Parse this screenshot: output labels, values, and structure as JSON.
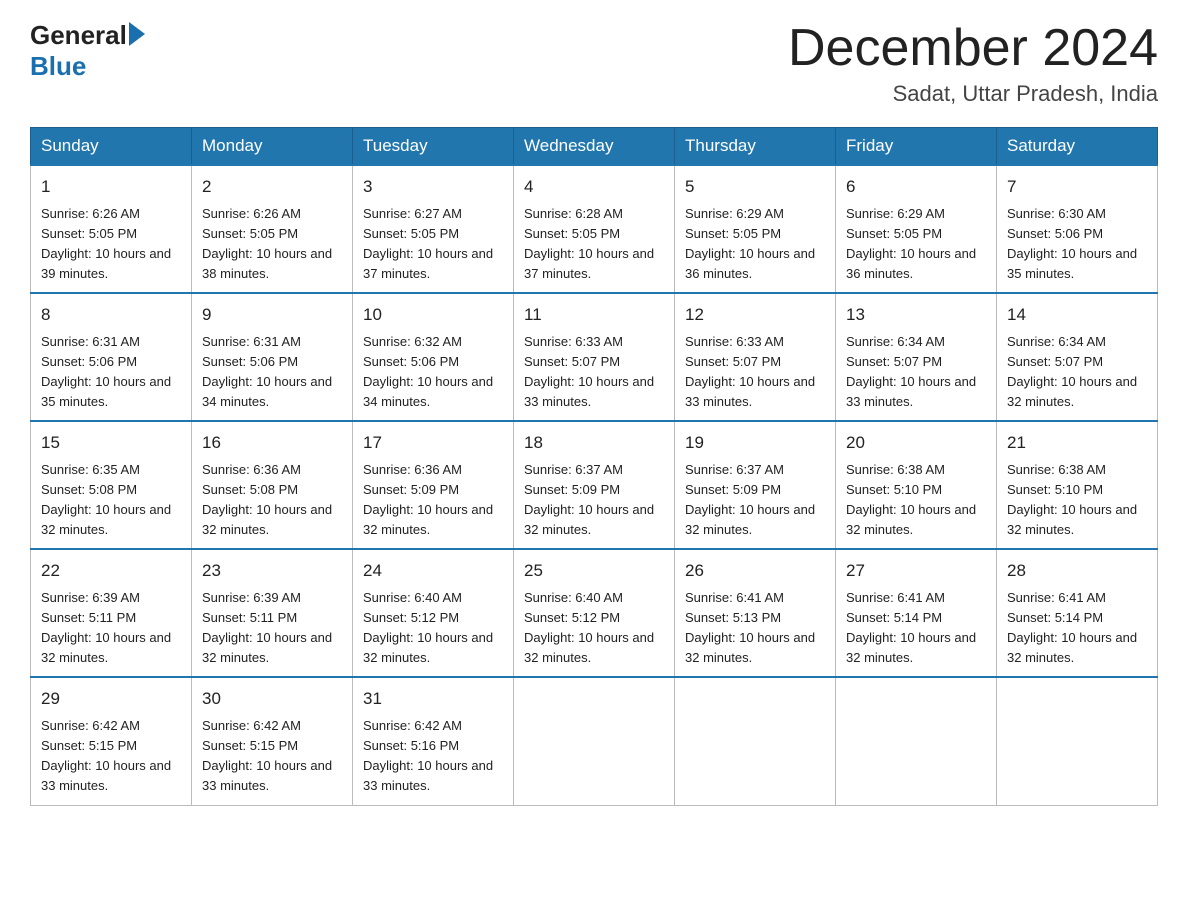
{
  "header": {
    "logo_general": "General",
    "logo_blue": "Blue",
    "title": "December 2024",
    "location": "Sadat, Uttar Pradesh, India"
  },
  "weekdays": [
    "Sunday",
    "Monday",
    "Tuesday",
    "Wednesday",
    "Thursday",
    "Friday",
    "Saturday"
  ],
  "weeks": [
    [
      {
        "day": "1",
        "sunrise": "6:26 AM",
        "sunset": "5:05 PM",
        "daylight": "10 hours and 39 minutes."
      },
      {
        "day": "2",
        "sunrise": "6:26 AM",
        "sunset": "5:05 PM",
        "daylight": "10 hours and 38 minutes."
      },
      {
        "day": "3",
        "sunrise": "6:27 AM",
        "sunset": "5:05 PM",
        "daylight": "10 hours and 37 minutes."
      },
      {
        "day": "4",
        "sunrise": "6:28 AM",
        "sunset": "5:05 PM",
        "daylight": "10 hours and 37 minutes."
      },
      {
        "day": "5",
        "sunrise": "6:29 AM",
        "sunset": "5:05 PM",
        "daylight": "10 hours and 36 minutes."
      },
      {
        "day": "6",
        "sunrise": "6:29 AM",
        "sunset": "5:05 PM",
        "daylight": "10 hours and 36 minutes."
      },
      {
        "day": "7",
        "sunrise": "6:30 AM",
        "sunset": "5:06 PM",
        "daylight": "10 hours and 35 minutes."
      }
    ],
    [
      {
        "day": "8",
        "sunrise": "6:31 AM",
        "sunset": "5:06 PM",
        "daylight": "10 hours and 35 minutes."
      },
      {
        "day": "9",
        "sunrise": "6:31 AM",
        "sunset": "5:06 PM",
        "daylight": "10 hours and 34 minutes."
      },
      {
        "day": "10",
        "sunrise": "6:32 AM",
        "sunset": "5:06 PM",
        "daylight": "10 hours and 34 minutes."
      },
      {
        "day": "11",
        "sunrise": "6:33 AM",
        "sunset": "5:07 PM",
        "daylight": "10 hours and 33 minutes."
      },
      {
        "day": "12",
        "sunrise": "6:33 AM",
        "sunset": "5:07 PM",
        "daylight": "10 hours and 33 minutes."
      },
      {
        "day": "13",
        "sunrise": "6:34 AM",
        "sunset": "5:07 PM",
        "daylight": "10 hours and 33 minutes."
      },
      {
        "day": "14",
        "sunrise": "6:34 AM",
        "sunset": "5:07 PM",
        "daylight": "10 hours and 32 minutes."
      }
    ],
    [
      {
        "day": "15",
        "sunrise": "6:35 AM",
        "sunset": "5:08 PM",
        "daylight": "10 hours and 32 minutes."
      },
      {
        "day": "16",
        "sunrise": "6:36 AM",
        "sunset": "5:08 PM",
        "daylight": "10 hours and 32 minutes."
      },
      {
        "day": "17",
        "sunrise": "6:36 AM",
        "sunset": "5:09 PM",
        "daylight": "10 hours and 32 minutes."
      },
      {
        "day": "18",
        "sunrise": "6:37 AM",
        "sunset": "5:09 PM",
        "daylight": "10 hours and 32 minutes."
      },
      {
        "day": "19",
        "sunrise": "6:37 AM",
        "sunset": "5:09 PM",
        "daylight": "10 hours and 32 minutes."
      },
      {
        "day": "20",
        "sunrise": "6:38 AM",
        "sunset": "5:10 PM",
        "daylight": "10 hours and 32 minutes."
      },
      {
        "day": "21",
        "sunrise": "6:38 AM",
        "sunset": "5:10 PM",
        "daylight": "10 hours and 32 minutes."
      }
    ],
    [
      {
        "day": "22",
        "sunrise": "6:39 AM",
        "sunset": "5:11 PM",
        "daylight": "10 hours and 32 minutes."
      },
      {
        "day": "23",
        "sunrise": "6:39 AM",
        "sunset": "5:11 PM",
        "daylight": "10 hours and 32 minutes."
      },
      {
        "day": "24",
        "sunrise": "6:40 AM",
        "sunset": "5:12 PM",
        "daylight": "10 hours and 32 minutes."
      },
      {
        "day": "25",
        "sunrise": "6:40 AM",
        "sunset": "5:12 PM",
        "daylight": "10 hours and 32 minutes."
      },
      {
        "day": "26",
        "sunrise": "6:41 AM",
        "sunset": "5:13 PM",
        "daylight": "10 hours and 32 minutes."
      },
      {
        "day": "27",
        "sunrise": "6:41 AM",
        "sunset": "5:14 PM",
        "daylight": "10 hours and 32 minutes."
      },
      {
        "day": "28",
        "sunrise": "6:41 AM",
        "sunset": "5:14 PM",
        "daylight": "10 hours and 32 minutes."
      }
    ],
    [
      {
        "day": "29",
        "sunrise": "6:42 AM",
        "sunset": "5:15 PM",
        "daylight": "10 hours and 33 minutes."
      },
      {
        "day": "30",
        "sunrise": "6:42 AM",
        "sunset": "5:15 PM",
        "daylight": "10 hours and 33 minutes."
      },
      {
        "day": "31",
        "sunrise": "6:42 AM",
        "sunset": "5:16 PM",
        "daylight": "10 hours and 33 minutes."
      },
      null,
      null,
      null,
      null
    ]
  ],
  "colors": {
    "header_bg": "#2176ae",
    "header_text": "#ffffff",
    "accent": "#1a6faf"
  }
}
